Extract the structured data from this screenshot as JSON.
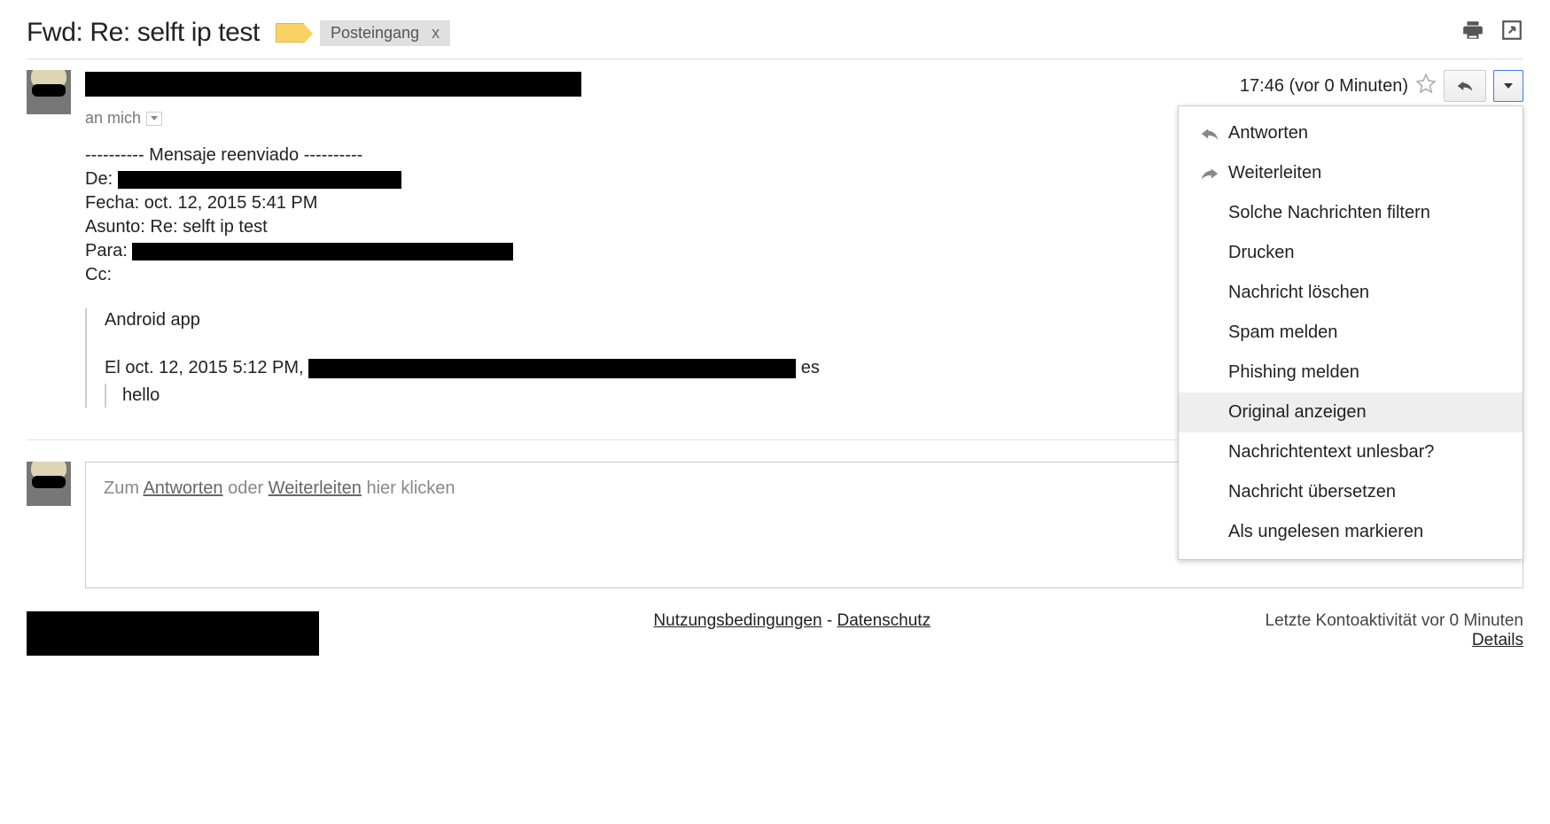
{
  "subject": "Fwd: Re: selft ip test",
  "label_pill": "Posteingang",
  "timestamp": "17:46 (vor 0 Minuten)",
  "to_line": "an mich",
  "forward_header": {
    "divider": "---------- Mensaje reenviado ----------",
    "de_label": "De:",
    "fecha_label": "Fecha:",
    "fecha_value": "oct. 12, 2015 5:41 PM",
    "asunto_label": "Asunto:",
    "asunto_value": "Re: selft ip test",
    "para_label": "Para:",
    "cc_label": "Cc:"
  },
  "quote": {
    "line1": "Android app",
    "line2_prefix": "El oct. 12, 2015 5:12 PM, ",
    "line2_suffix": " es",
    "inner": "hello"
  },
  "reply_prompt": {
    "prefix": "Zum ",
    "reply": "Antworten",
    "mid": " oder ",
    "forward": "Weiterleiten",
    "suffix": " hier klicken"
  },
  "footer": {
    "terms": "Nutzungsbedingungen",
    "sep": " - ",
    "privacy": "Datenschutz",
    "activity": "Letzte Kontoaktivität vor 0 Minuten",
    "details": "Details"
  },
  "dropdown": [
    {
      "label": "Antworten",
      "icon": "reply"
    },
    {
      "label": "Weiterleiten",
      "icon": "forward"
    },
    {
      "label": "Solche Nachrichten filtern",
      "icon": ""
    },
    {
      "label": "Drucken",
      "icon": ""
    },
    {
      "label": "Nachricht löschen",
      "icon": ""
    },
    {
      "label": "Spam melden",
      "icon": ""
    },
    {
      "label": "Phishing melden",
      "icon": ""
    },
    {
      "label": "Original anzeigen",
      "icon": "",
      "hover": true
    },
    {
      "label": "Nachrichtentext unlesbar?",
      "icon": ""
    },
    {
      "label": "Nachricht übersetzen",
      "icon": ""
    },
    {
      "label": "Als ungelesen markieren",
      "icon": ""
    }
  ]
}
